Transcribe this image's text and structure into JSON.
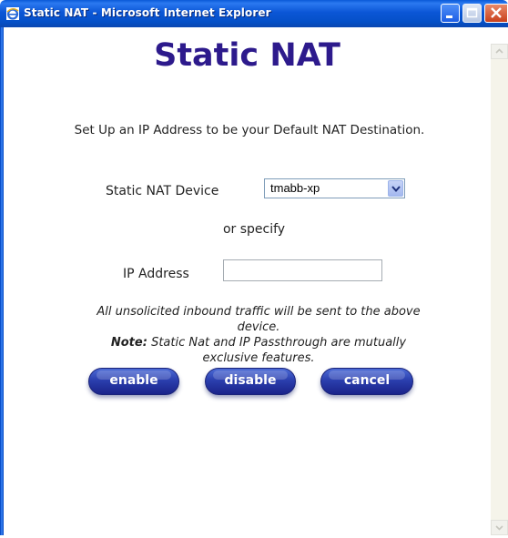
{
  "window": {
    "title": "Static NAT - Microsoft Internet Explorer",
    "app_icon": "ie-icon",
    "controls": [
      "minimize-icon",
      "maximize-icon",
      "close-icon"
    ]
  },
  "page": {
    "heading": "Static NAT",
    "intro": "Set Up an IP Address to be your Default NAT Destination.",
    "device": {
      "label": "Static NAT Device",
      "selected": "tmabb-xp"
    },
    "or_specify": "or specify",
    "ip": {
      "label": "IP Address",
      "value": "",
      "placeholder": ""
    },
    "note": {
      "line1": "All unsolicited inbound traffic will be sent to the above device.",
      "note_label": "Note:",
      "note_text": "Static Nat and IP Passthrough are mutually exclusive features."
    },
    "buttons": {
      "enable": "enable",
      "disable": "disable",
      "cancel": "cancel"
    }
  },
  "colors": {
    "titlebar": "#0b56d6",
    "heading": "#2d1a8c",
    "button": "#2b3fae"
  }
}
